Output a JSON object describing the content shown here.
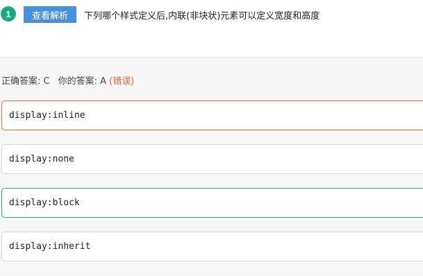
{
  "question": {
    "number": "1",
    "analysis_button": "查看解析",
    "text": "下列哪个样式定义后,内联(非块状)元素可以定义宽度和高度"
  },
  "answer": {
    "correct_label": "正确答案: C",
    "your_label": "你的答案: A",
    "result": "(错误)"
  },
  "options": [
    {
      "text": "display:inline",
      "state": "wrong"
    },
    {
      "text": "display:none",
      "state": "normal"
    },
    {
      "text": "display:block",
      "state": "correct"
    },
    {
      "text": "display:inherit",
      "state": "normal"
    }
  ],
  "colors": {
    "number_badge": "#1ba784",
    "analysis_button": "#4a90d9",
    "wrong": "#e06a4e",
    "correct": "#2ea37e"
  }
}
